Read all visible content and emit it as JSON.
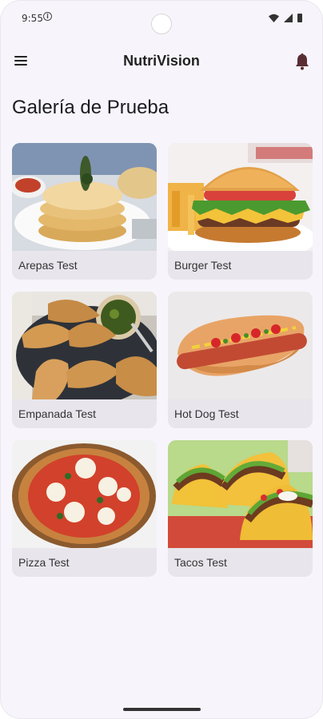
{
  "status_bar": {
    "time": "9:55",
    "icons": [
      "info-icon",
      "wifi-icon",
      "signal-icon",
      "battery-icon"
    ]
  },
  "app_bar": {
    "title": "NutriVision",
    "left_icon": "menu-icon",
    "right_icon": "notification-bell-icon"
  },
  "page": {
    "title": "Galería de Prueba"
  },
  "gallery": {
    "items": [
      {
        "label": "Arepas Test",
        "image": "arepas-photo"
      },
      {
        "label": "Burger Test",
        "image": "burger-photo"
      },
      {
        "label": "Empanada Test",
        "image": "empanada-photo"
      },
      {
        "label": "Hot Dog Test",
        "image": "hotdog-photo"
      },
      {
        "label": "Pizza Test",
        "image": "pizza-photo"
      },
      {
        "label": "Tacos Test",
        "image": "tacos-photo"
      }
    ]
  },
  "colors": {
    "background": "#f7f5fb",
    "card": "#e8e6ec",
    "text": "#1b1b1f"
  }
}
